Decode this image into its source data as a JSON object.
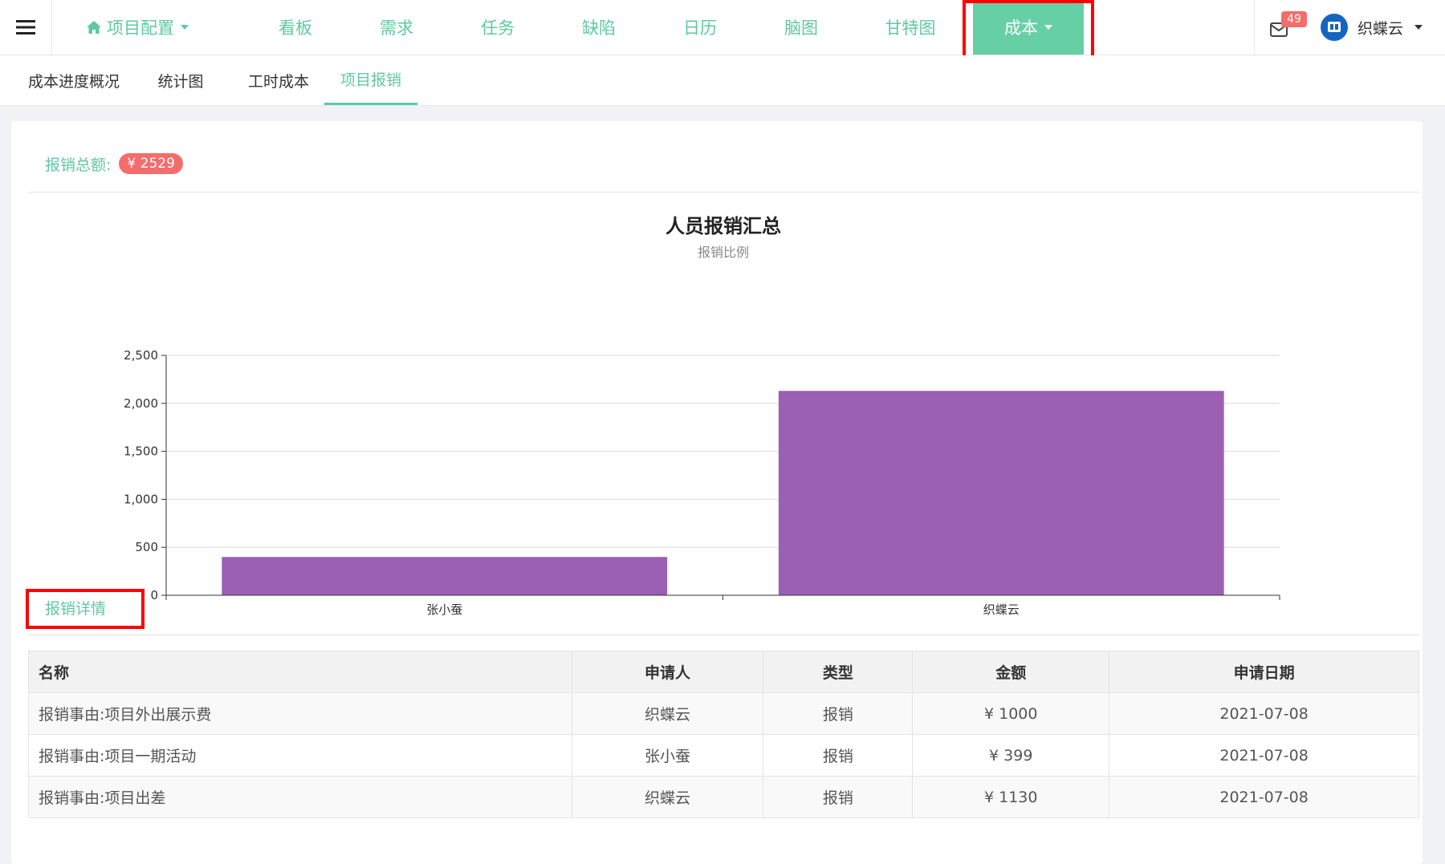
{
  "topnav": {
    "home": {
      "label": "项目配置",
      "icon": "home-icon"
    },
    "items": [
      "看板",
      "需求",
      "任务",
      "缺陷",
      "日历",
      "脑图",
      "甘特图"
    ],
    "active": {
      "label": "成本"
    },
    "mail_badge": "49",
    "user_name": "织蝶云"
  },
  "subtabs": {
    "items": [
      "成本进度概况",
      "统计图",
      "工时成本",
      "项目报销"
    ],
    "active_index": 3
  },
  "summary": {
    "label": "报销总额:",
    "total": "¥ 2529"
  },
  "chart_data": {
    "type": "bar",
    "title": "人员报销汇总",
    "subtitle": "报销比例",
    "categories": [
      "张小蚕",
      "织蝶云"
    ],
    "values": [
      399,
      2130
    ],
    "ylim": [
      0,
      2500
    ],
    "yticks": [
      0,
      500,
      1000,
      1500,
      2000,
      2500
    ],
    "ytick_labels": [
      "0",
      "500",
      "1,000",
      "1,500",
      "2,000",
      "2,500"
    ],
    "bar_color": "#9b5fb4",
    "grid": true
  },
  "details": {
    "title": "报销详情",
    "columns": [
      "名称",
      "申请人",
      "类型",
      "金额",
      "申请日期"
    ],
    "rows": [
      [
        "报销事由:项目外出展示费",
        "织蝶云",
        "报销",
        "¥ 1000",
        "2021-07-08"
      ],
      [
        "报销事由:项目一期活动",
        "张小蚕",
        "报销",
        "¥ 399",
        "2021-07-08"
      ],
      [
        "报销事由:项目出差",
        "织蝶云",
        "报销",
        "¥ 1130",
        "2021-07-08"
      ]
    ]
  },
  "colors": {
    "accent": "#5ec9a1",
    "active_nav_bg": "#66cfa6",
    "badge_red": "#f56c6c",
    "highlight": "#ff0000"
  }
}
